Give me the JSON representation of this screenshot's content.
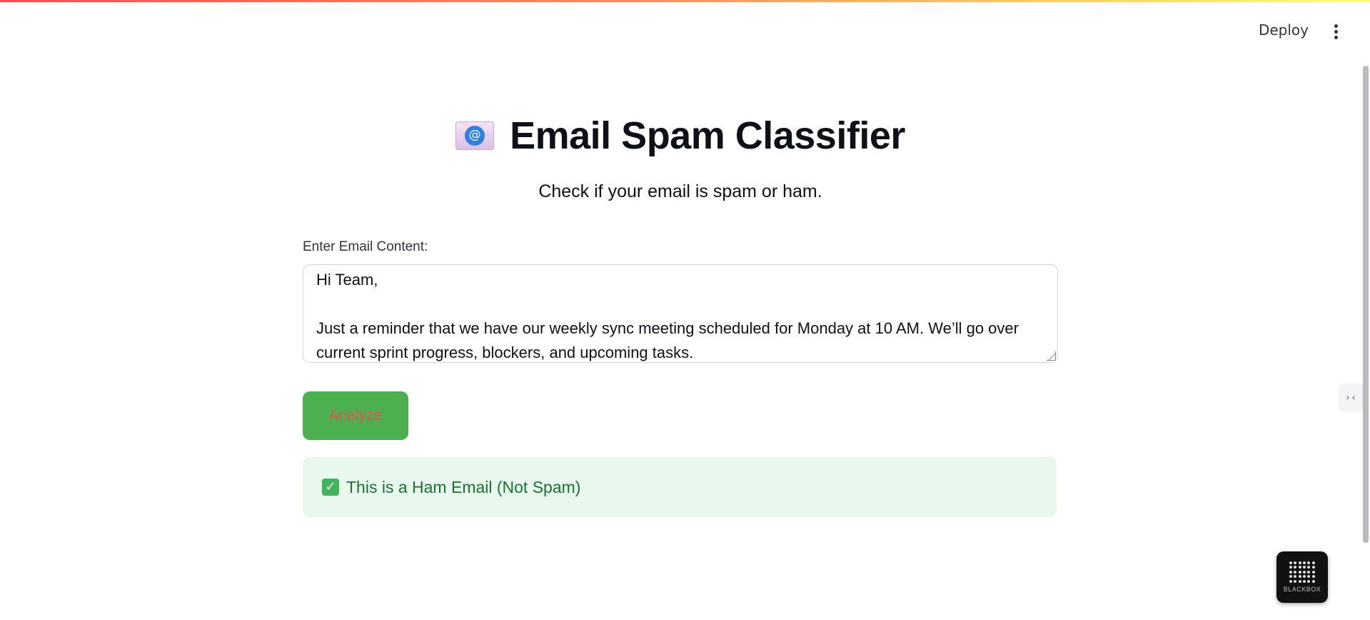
{
  "header": {
    "deploy_label": "Deploy",
    "menu_icon": "more-vertical-icon"
  },
  "main": {
    "title_icon": "email-envelope-icon",
    "title_icon_symbol": "@",
    "title": "Email Spam Classifier",
    "subtitle": "Check if your email is spam or ham.",
    "input": {
      "label": "Enter Email Content:",
      "value": "Hi Team,\n\nJust a reminder that we have our weekly sync meeting scheduled for Monday at 10 AM. We’ll go over current sprint progress, blockers, and upcoming tasks."
    },
    "analyze_label": "Analyze",
    "result": {
      "icon": "check-mark-icon",
      "text": "This is a Ham Email (Not Spam)"
    }
  },
  "widgets": {
    "side_toggle_icon": "collapse-code-icon",
    "side_toggle_glyph": "›‹",
    "badge_label": "BLACKBOX"
  },
  "colors": {
    "primary_button": "#4caf50",
    "button_text": "#e25555",
    "success_bg": "#e8f8ec",
    "success_text": "#177233"
  }
}
